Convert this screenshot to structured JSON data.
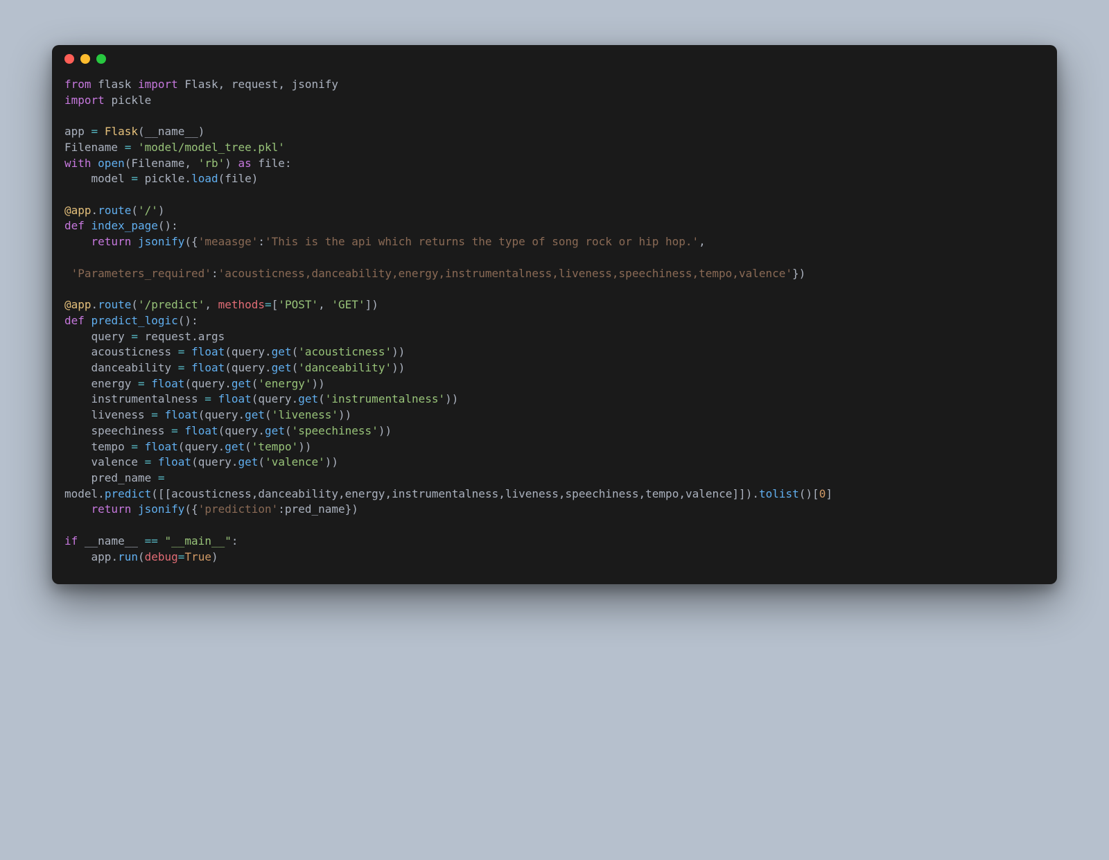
{
  "code_lines": {
    "l0": "from flask import Flask, request, jsonify",
    "l1": "import pickle",
    "l2": "",
    "l3": "app = Flask(__name__)",
    "l4": "Filename = 'model/model_tree.pkl'",
    "l5": "with open(Filename, 'rb') as file:",
    "l6": "    model = pickle.load(file)",
    "l7": "",
    "l8": "@app.route('/')",
    "l9": "def index_page():",
    "l10": "    return jsonify({'meaasge':'This is the api which returns the type of song rock or hip hop.',",
    "l11": "",
    "l12": " 'Parameters_required':'acousticness,danceability,energy,instrumentalness,liveness,speechiness,tempo,valence'})",
    "l13": "",
    "l14": "@app.route('/predict', methods=['POST', 'GET'])",
    "l15": "def predict_logic():",
    "l16": "    query = request.args",
    "l17": "    acousticness = float(query.get('acousticness'))",
    "l18": "    danceability = float(query.get('danceability'))",
    "l19": "    energy = float(query.get('energy'))",
    "l20": "    instrumentalness = float(query.get('instrumentalness'))",
    "l21": "    liveness = float(query.get('liveness'))",
    "l22": "    speechiness = float(query.get('speechiness'))",
    "l23": "    tempo = float(query.get('tempo'))",
    "l24": "    valence = float(query.get('valence'))",
    "l25": "    pred_name = ",
    "l26": "model.predict([[acousticness,danceability,energy,instrumentalness,liveness,speechiness,tempo,valence]]).tolist()[0]",
    "l27": "    return jsonify({'prediction':pred_name})",
    "l28": "",
    "l29": "if __name__ == \"__main__\":",
    "l30": "    app.run(debug=True)"
  },
  "tokens": {
    "from": "from",
    "flask": "flask",
    "import": "import",
    "Flask": "Flask",
    "request": "request",
    "jsonify": "jsonify",
    "pickle": "pickle",
    "app": "app",
    "eq": "=",
    "lp": "(",
    "rp": ")",
    "name": "__name__",
    "Filename": "Filename",
    "s_model": "'model/model_tree.pkl'",
    "with": "with",
    "open": "open",
    "s_rb": "'rb'",
    "as": "as",
    "file": "file",
    "colon": ":",
    "model": "model",
    "dot": ".",
    "load": "load",
    "at": "@",
    "route": "route",
    "s_slash": "'/'",
    "def": "def",
    "index_page": "index_page",
    "return": "return",
    "lb": "{",
    "rb": "}",
    "s_meaasge": "'meaasge'",
    "s_msg": "'This is the api which returns the type of song rock or hip hop.'",
    "comma": ",",
    "s_params": "'Parameters_required'",
    "s_paramlist": "'acousticness,danceability,energy,instrumentalness,liveness,speechiness,tempo,valence'",
    "s_predict": "'/predict'",
    "methods": "methods",
    "sqo": "[",
    "sqc": "]",
    "s_post": "'POST'",
    "s_get": "'GET'",
    "predict_logic": "predict_logic",
    "query": "query",
    "args": "args",
    "acousticness": "acousticness",
    "danceability": "danceability",
    "energy": "energy",
    "instrumentalness": "instrumentalness",
    "liveness": "liveness",
    "speechiness": "speechiness",
    "tempo": "tempo",
    "valence": "valence",
    "float": "float",
    "get": "get",
    "s_ac": "'acousticness'",
    "s_da": "'danceability'",
    "s_en": "'energy'",
    "s_in": "'instrumentalness'",
    "s_li": "'liveness'",
    "s_sp": "'speechiness'",
    "s_te": "'tempo'",
    "s_va": "'valence'",
    "pred_name": "pred_name",
    "predict": "predict",
    "tolist": "tolist",
    "zero": "0",
    "s_prediction": "'prediction'",
    "if": "if",
    "s_main": "\"__main__\"",
    "eqeq": "==",
    "run": "run",
    "debug": "debug",
    "True": "True",
    "sp4": "    ",
    "sp1": " "
  }
}
